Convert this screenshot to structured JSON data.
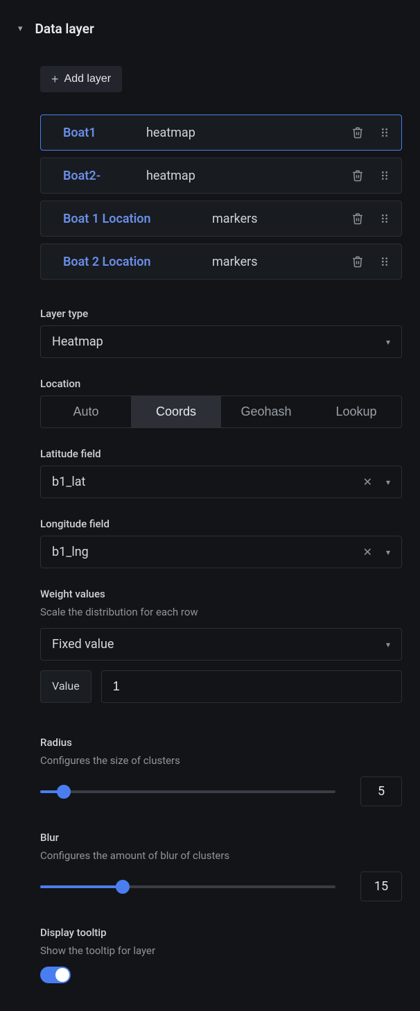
{
  "section": {
    "title": "Data layer"
  },
  "addLayer": {
    "label": "Add layer"
  },
  "layers": [
    {
      "name": "Boat1",
      "type": "heatmap",
      "selected": true,
      "wide": false
    },
    {
      "name": "Boat2-",
      "type": "heatmap",
      "selected": false,
      "wide": false
    },
    {
      "name": "Boat 1 Location",
      "type": "markers",
      "selected": false,
      "wide": true
    },
    {
      "name": "Boat 2 Location",
      "type": "markers",
      "selected": false,
      "wide": true
    }
  ],
  "layerType": {
    "label": "Layer type",
    "value": "Heatmap"
  },
  "location": {
    "label": "Location",
    "options": [
      "Auto",
      "Coords",
      "Geohash",
      "Lookup"
    ],
    "active": "Coords"
  },
  "latitude": {
    "label": "Latitude field",
    "value": "b1_lat"
  },
  "longitude": {
    "label": "Longitude field",
    "value": "b1_lng"
  },
  "weight": {
    "label": "Weight values",
    "desc": "Scale the distribution for each row",
    "mode": "Fixed value",
    "valueLabel": "Value",
    "value": "1"
  },
  "radius": {
    "label": "Radius",
    "desc": "Configures the size of clusters",
    "value": "5",
    "pct": 8
  },
  "blur": {
    "label": "Blur",
    "desc": "Configures the amount of blur of clusters",
    "value": "15",
    "pct": 28
  },
  "tooltip": {
    "label": "Display tooltip",
    "desc": "Show the tooltip for layer",
    "on": true
  }
}
